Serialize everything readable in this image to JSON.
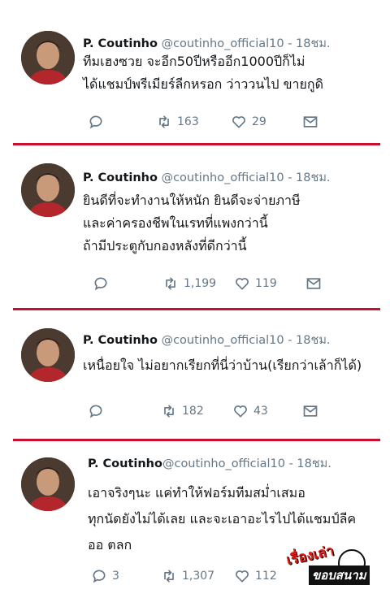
{
  "tweets": [
    {
      "name": "P. Coutinho",
      "handle": "@coutinho_official10",
      "time": "- 18ชม.",
      "lines": [
        "ทีมเฮงซวย จะอีก50ปีหรืออีก1000ปีก็ไม่",
        "ได้แชมป์พรีเมียร์ลีกหรอก ว่าววนไป ขายกูดิ"
      ],
      "reply_count": "",
      "retweet_count": "163",
      "like_count": "29"
    },
    {
      "name": "P. Coutinho",
      "handle": "@coutinho_official10",
      "time": "- 18ชม.",
      "lines": [
        "ยินดีที่จะทำงานให้หนัก ยินดีจะจ่ายภาษี",
        "และค่าครองชีพในเรทที่แพงกว่านี้",
        "ถ้ามีประตูกับกองหลังที่ดีกว่านี้"
      ],
      "reply_count": "",
      "retweet_count": "1,199",
      "like_count": "119"
    },
    {
      "name": "P. Coutinho",
      "handle": "@coutinho_official10",
      "time": "- 18ชม.",
      "lines": [
        "เหนื่อยใจ ไม่อยากเรียกที่นี่ว่าบ้าน(เรียกว่าเล้าก็ได้)"
      ],
      "reply_count": "",
      "retweet_count": "182",
      "like_count": "43"
    },
    {
      "name": "P. Coutinho",
      "handle": "@coutinho_official10",
      "time": "- 18ชม.",
      "lines": [
        "เอาจริงๆนะ แค่ทำให้ฟอร์มทีมสม่ำเสมอ",
        "ทุกนัดยังไม่ได้เลย และจะเอาอะไรไปได้แชมป์ลีค",
        "ออ ตลก"
      ],
      "reply_count": "3",
      "retweet_count": "1,307",
      "like_count": "112"
    }
  ],
  "icons": {
    "reply": "reply-icon",
    "retweet": "retweet-icon",
    "like": "heart-icon",
    "dm": "envelope-icon"
  },
  "colors": {
    "divider": "#c8102e",
    "text": "#14171a",
    "muted": "#657786"
  },
  "watermark": {
    "line1": "เรื่องเล่า",
    "line2": "ขอบสนาม"
  }
}
